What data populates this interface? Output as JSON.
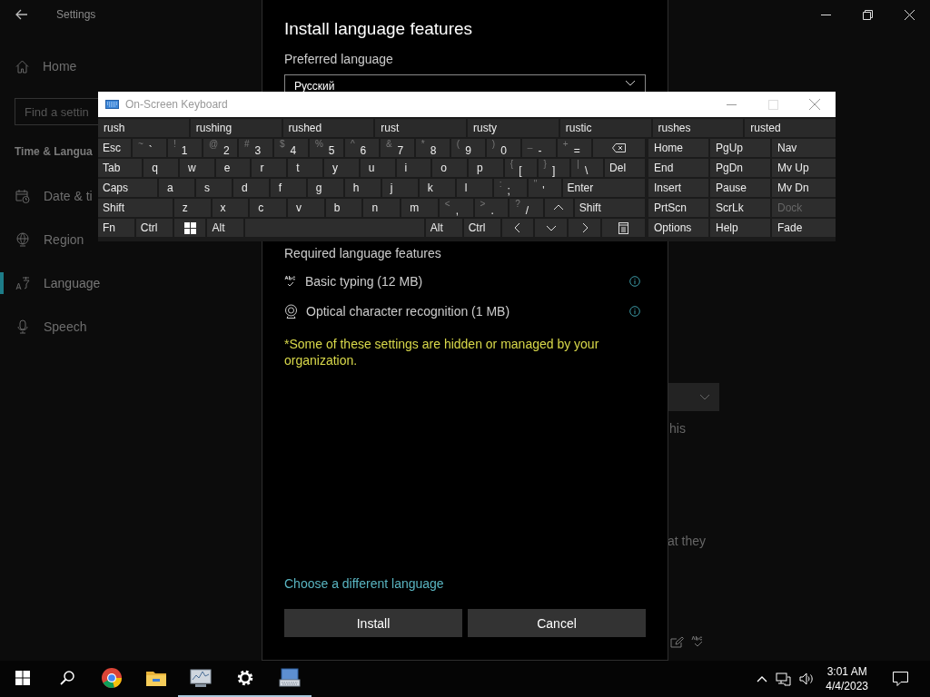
{
  "settings_window": {
    "title": "Settings",
    "home": "Home",
    "search": {
      "placeholder": "Find a settin"
    },
    "section": "Time & Langua",
    "nav": [
      {
        "label": "Date & ti",
        "kind": "calendar",
        "selected": false
      },
      {
        "label": "Region",
        "kind": "globe",
        "selected": false
      },
      {
        "label": "Language",
        "kind": "language",
        "selected": true
      },
      {
        "label": "Speech",
        "kind": "microphone",
        "selected": false
      }
    ],
    "fragments": [
      "his",
      "at they"
    ]
  },
  "dialog": {
    "title": "Install language features",
    "preferred_label": "Preferred language",
    "preferred_value": "Русский",
    "required_heading": "Required language features",
    "features": [
      {
        "label": "Basic typing (12 MB)",
        "kind": "typing"
      },
      {
        "label": "Optical character recognition (1 MB)",
        "kind": "ocr"
      }
    ],
    "note": "*Some of these settings are hidden or managed by your organization.",
    "link": "Choose a different language",
    "buttons": [
      "Install",
      "Cancel"
    ]
  },
  "keyboard": {
    "title": "On-Screen Keyboard",
    "suggestions": [
      "rush",
      "rushing",
      "rushed",
      "rust",
      "rusty",
      "rustic",
      "rushes",
      "rusted"
    ],
    "rows": [
      [
        {
          "label": "Esc"
        },
        {
          "shift": "~",
          "label": "`"
        },
        {
          "shift": "!",
          "label": "1"
        },
        {
          "shift": "@",
          "label": "2"
        },
        {
          "shift": "#",
          "label": "3"
        },
        {
          "shift": "$",
          "label": "4"
        },
        {
          "shift": "%",
          "label": "5"
        },
        {
          "shift": "^",
          "label": "6"
        },
        {
          "shift": "&",
          "label": "7"
        },
        {
          "shift": "*",
          "label": "8"
        },
        {
          "shift": "(",
          "label": "9"
        },
        {
          "shift": ")",
          "label": "0"
        },
        {
          "shift": "_",
          "label": "-"
        },
        {
          "shift": "+",
          "label": "="
        },
        {
          "kind": "backspace"
        }
      ],
      [
        {
          "label": "Tab"
        },
        {
          "label": "q"
        },
        {
          "label": "w"
        },
        {
          "label": "e"
        },
        {
          "label": "r"
        },
        {
          "label": "t"
        },
        {
          "label": "y"
        },
        {
          "label": "u"
        },
        {
          "label": "i"
        },
        {
          "label": "o"
        },
        {
          "label": "p"
        },
        {
          "shift": "{",
          "label": "["
        },
        {
          "shift": "}",
          "label": "]"
        },
        {
          "shift": "|",
          "label": "\\"
        },
        {
          "label": "Del"
        }
      ],
      [
        {
          "label": "Caps"
        },
        {
          "label": "a"
        },
        {
          "label": "s"
        },
        {
          "label": "d"
        },
        {
          "label": "f"
        },
        {
          "label": "g"
        },
        {
          "label": "h"
        },
        {
          "label": "j"
        },
        {
          "label": "k"
        },
        {
          "label": "l"
        },
        {
          "shift": ":",
          "label": ";"
        },
        {
          "shift": "\"",
          "label": "'"
        },
        {
          "label": "Enter"
        }
      ],
      [
        {
          "label": "Shift"
        },
        {
          "label": "z"
        },
        {
          "label": "x"
        },
        {
          "label": "c"
        },
        {
          "label": "v"
        },
        {
          "label": "b"
        },
        {
          "label": "n"
        },
        {
          "label": "m"
        },
        {
          "shift": "<",
          "label": ","
        },
        {
          "shift": ">",
          "label": "."
        },
        {
          "shift": "?",
          "label": "/"
        },
        {
          "kind": "up"
        },
        {
          "label": "Shift"
        }
      ],
      [
        {
          "label": "Fn"
        },
        {
          "label": "Ctrl"
        },
        {
          "kind": "windows"
        },
        {
          "label": "Alt"
        },
        {
          "kind": "space"
        },
        {
          "label": "Alt"
        },
        {
          "label": "Ctrl"
        },
        {
          "kind": "left"
        },
        {
          "kind": "down"
        },
        {
          "kind": "right"
        },
        {
          "kind": "menu"
        }
      ]
    ],
    "side_keys": [
      {
        "label": "Home",
        "disabled": false
      },
      {
        "label": "PgUp",
        "disabled": false
      },
      {
        "label": "Nav",
        "disabled": false
      },
      {
        "label": "End",
        "disabled": false
      },
      {
        "label": "PgDn",
        "disabled": false
      },
      {
        "label": "Mv Up",
        "disabled": false
      },
      {
        "label": "Insert",
        "disabled": false
      },
      {
        "label": "Pause",
        "disabled": false
      },
      {
        "label": "Mv Dn",
        "disabled": false
      },
      {
        "label": "PrtScn",
        "disabled": false
      },
      {
        "label": "ScrLk",
        "disabled": false
      },
      {
        "label": "Dock",
        "disabled": true
      },
      {
        "label": "Options",
        "disabled": false
      },
      {
        "label": "Help",
        "disabled": false
      },
      {
        "label": "Fade",
        "disabled": false
      }
    ]
  },
  "taskbar": {
    "apps": [
      {
        "kind": "start",
        "open": false
      },
      {
        "kind": "search",
        "open": false
      },
      {
        "kind": "browser",
        "open": false
      },
      {
        "kind": "folder",
        "open": false
      },
      {
        "kind": "monitor",
        "open": true
      },
      {
        "kind": "settings",
        "open": true
      },
      {
        "kind": "keyboard",
        "open": true
      }
    ],
    "time": "3:01 AM",
    "date": "4/4/2023"
  }
}
